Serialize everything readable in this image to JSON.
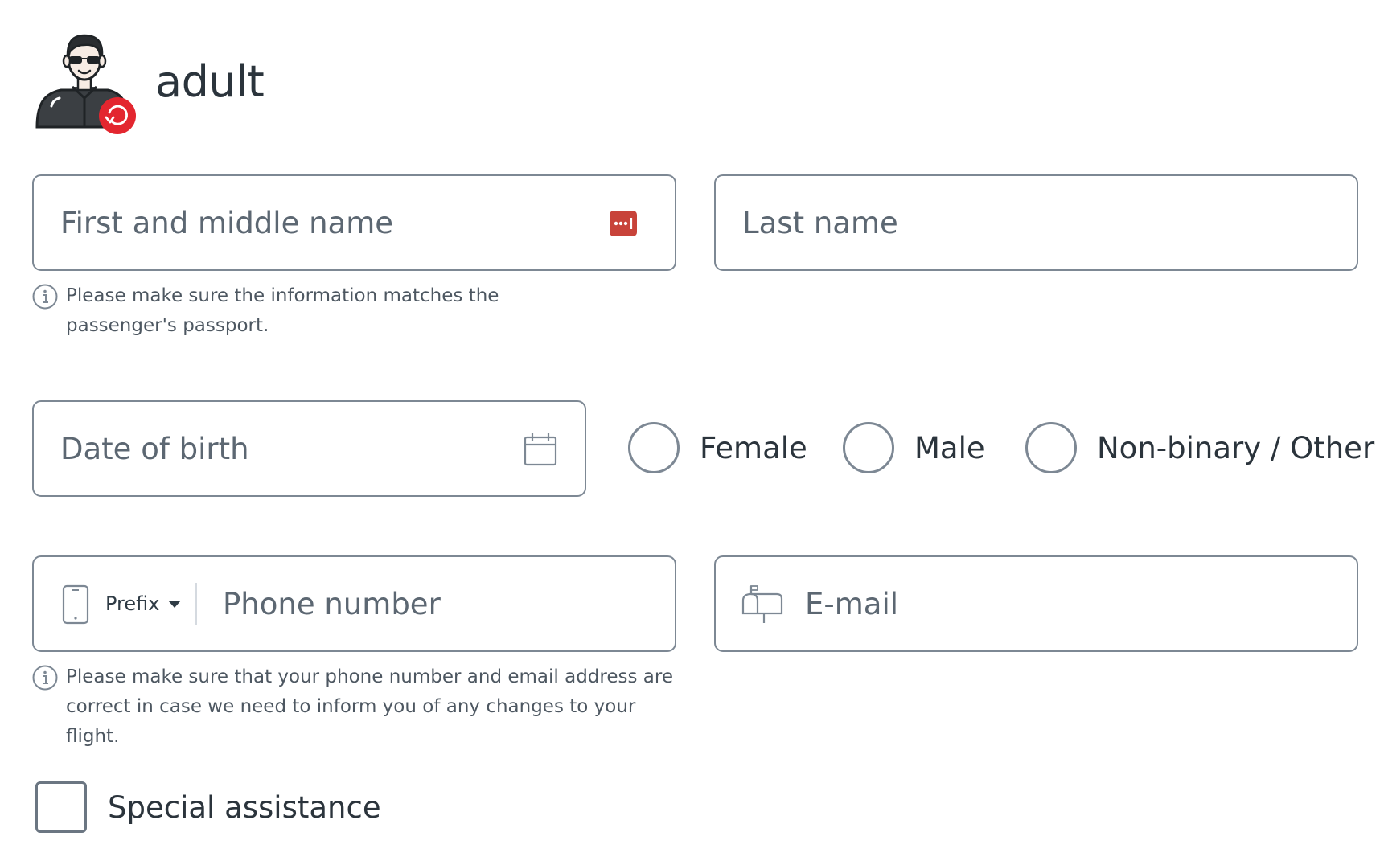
{
  "passenger": {
    "title": "adult"
  },
  "fields": {
    "first_name": {
      "placeholder": "First and middle name"
    },
    "last_name": {
      "placeholder": "Last name"
    },
    "date_of_birth": {
      "placeholder": "Date of birth"
    },
    "phone": {
      "prefix_label": "Prefix",
      "placeholder": "Phone number"
    },
    "email": {
      "placeholder": "E-mail"
    }
  },
  "hints": {
    "name": "Please make sure the information matches the passenger's passport.",
    "contact": "Please make sure that your phone number and email address are correct in case we need to inform you of any changes to your flight."
  },
  "gender": {
    "options": [
      "Female",
      "Male",
      "Non-binary / Other"
    ]
  },
  "special_assistance": {
    "label": "Special assistance"
  },
  "colors": {
    "border": "#7d8894",
    "text": "#2b343c",
    "accent_red": "#e3262f",
    "password_badge": "#c8433a"
  },
  "icons": {
    "avatar": "passenger-avatar-icon",
    "change": "refresh-icon",
    "password_manager": "password-dots-icon",
    "calendar": "calendar-icon",
    "phone": "mobile-phone-icon",
    "prefix_caret": "caret-down-icon",
    "email": "mailbox-icon",
    "info": "info-icon"
  }
}
